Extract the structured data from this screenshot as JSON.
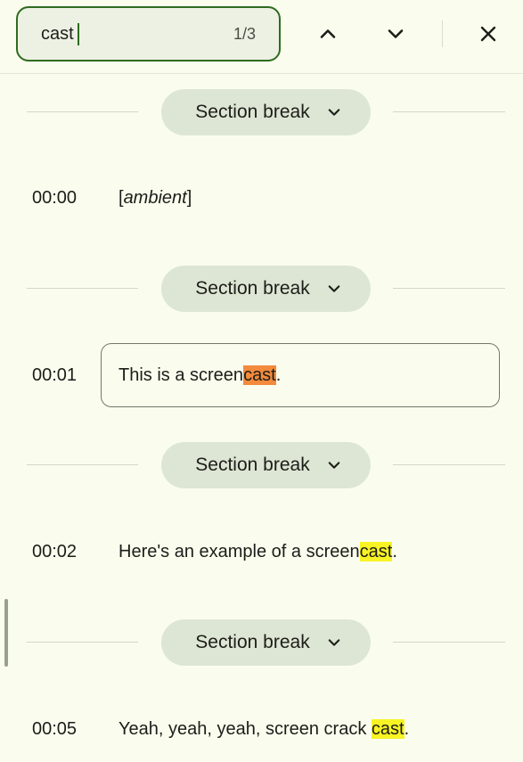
{
  "search": {
    "value": "cast",
    "match_count": "1/3"
  },
  "toolbar": {
    "prev_icon": "chevron-up-icon",
    "next_icon": "chevron-down-icon",
    "close_icon": "close-icon"
  },
  "section_break_label": "Section break",
  "transcript": [
    {
      "time": "00:00",
      "pre": "[",
      "italic": "ambient",
      "post": "]"
    },
    {
      "time": "00:01",
      "pre": "This is a screen",
      "match": "cast",
      "post": "."
    },
    {
      "time": "00:02",
      "pre": "Here's an example of a screen",
      "match": "cast",
      "post": "."
    },
    {
      "time": "00:05",
      "pre": "Yeah, yeah, yeah, screen crack ",
      "match": "cast",
      "post": "."
    }
  ],
  "colors": {
    "background": "#fafdee",
    "accent": "#2e6b1f",
    "current_match": "#f38a3c",
    "other_match": "#f7f325"
  }
}
